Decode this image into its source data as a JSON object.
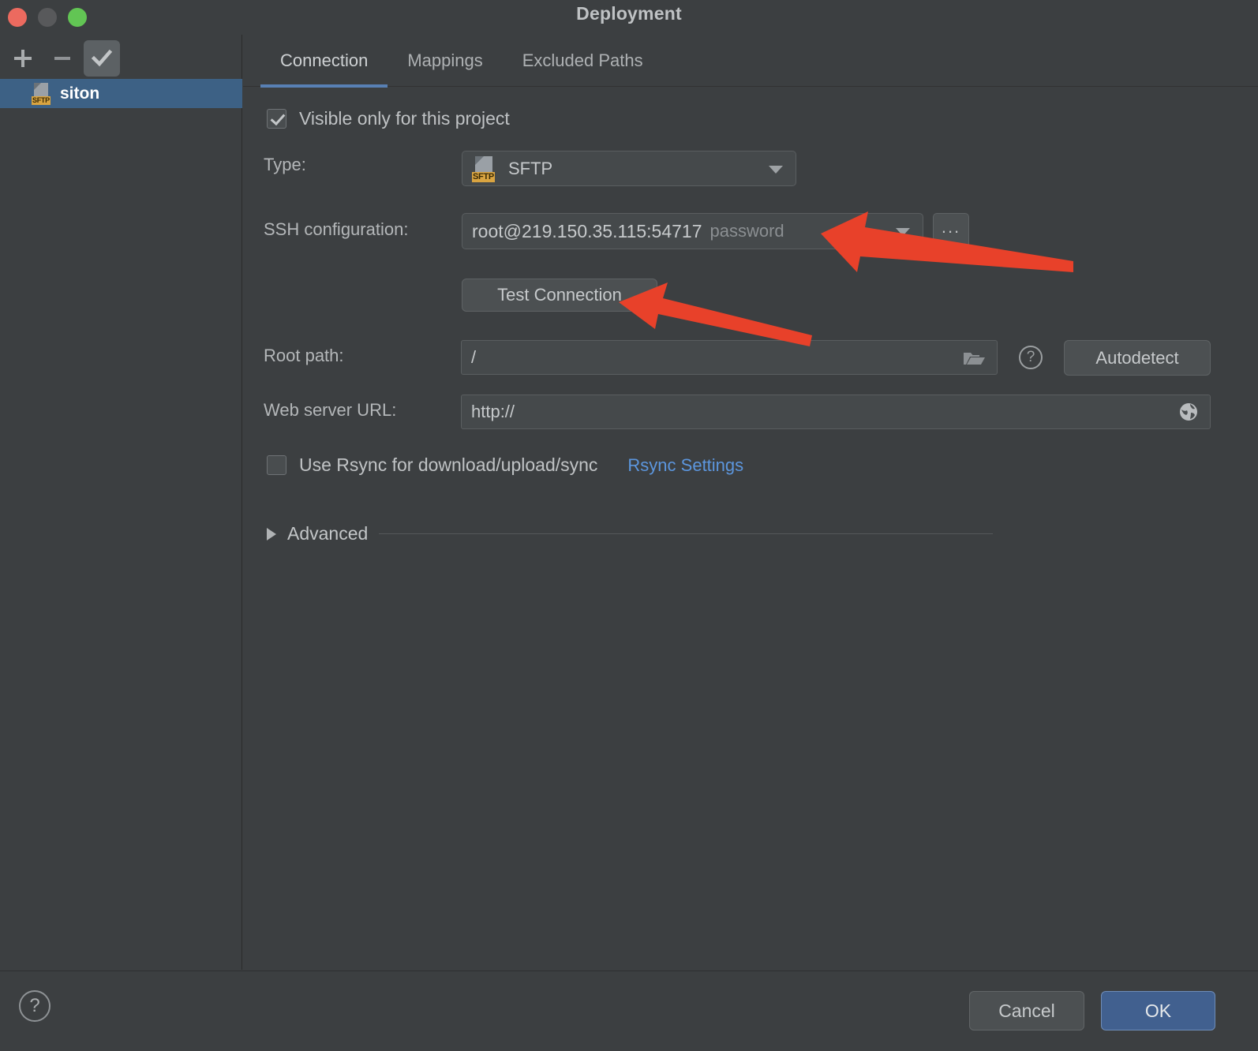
{
  "window": {
    "title": "Deployment",
    "traffic_lights": [
      "close",
      "minimize",
      "zoom"
    ]
  },
  "sidebar": {
    "toolbar": [
      {
        "name": "add",
        "glyph": "+"
      },
      {
        "name": "remove",
        "glyph": "−"
      },
      {
        "name": "set-default",
        "glyph": "✓"
      }
    ],
    "items": [
      {
        "label": "siton",
        "icon": "sftp-icon",
        "badge": "SFTP",
        "selected": true
      }
    ]
  },
  "tabs": [
    {
      "label": "Connection",
      "active": true
    },
    {
      "label": "Mappings",
      "active": false
    },
    {
      "label": "Excluded Paths",
      "active": false
    }
  ],
  "form": {
    "visible_only": {
      "label": "Visible only for this project",
      "checked": true
    },
    "type": {
      "label": "Type:",
      "value": "SFTP",
      "badge": "SFTP",
      "icon": "sftp-icon"
    },
    "ssh_configuration": {
      "label": "SSH configuration:",
      "value": "root@219.150.35.115:54717",
      "auth": "password",
      "browse_label": "...",
      "dropdown_icon": "chevron-down-icon"
    },
    "test_connection": {
      "label": "Test Connection"
    },
    "root_path": {
      "label": "Root path:",
      "value": "/",
      "browse_icon": "folder-icon",
      "help_icon": "question-mark-icon",
      "autodetect_label": "Autodetect"
    },
    "web_server_url": {
      "label": "Web server URL:",
      "value": "http://",
      "open_icon": "globe-icon"
    },
    "rsync": {
      "label": "Use Rsync for download/upload/sync",
      "checked": false,
      "settings_link": "Rsync Settings"
    },
    "advanced": {
      "label": "Advanced",
      "expanded": false,
      "toggle_icon": "triangle-right-icon"
    }
  },
  "footer": {
    "help_icon": "question-mark-icon",
    "cancel_label": "Cancel",
    "ok_label": "OK"
  },
  "annotations": [
    {
      "name": "arrow-to-ssh-configuration",
      "color": "#E8412A"
    },
    {
      "name": "arrow-to-test-connection",
      "color": "#E8412A"
    }
  ],
  "colors": {
    "accent_selection": "#3D6185",
    "tab_underline": "#5880B4",
    "link": "#5C96DE",
    "ok_button": "#41608F",
    "annotation_red": "#E8412A",
    "sftp_badge": "#D9A441"
  }
}
